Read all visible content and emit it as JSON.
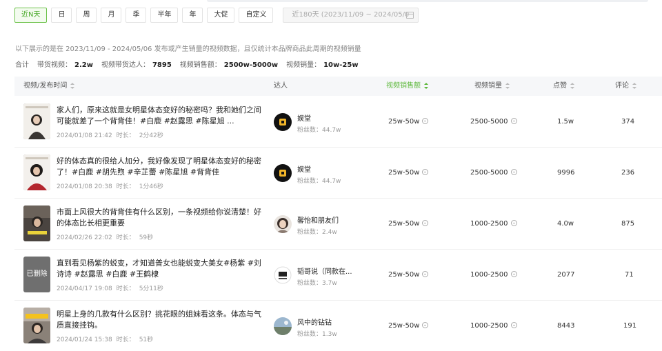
{
  "filters": {
    "options": [
      "近N天",
      "日",
      "周",
      "月",
      "季",
      "半年",
      "年",
      "大促",
      "自定义"
    ],
    "active_index": 0,
    "date_range": "近180天 (2023/11/09 ~ 2024/05/0"
  },
  "note": "以下展示的是在 2023/11/09 - 2024/05/06 发布或产生销量的视频数据，且仅统计本品牌商品此周期的视频销量",
  "summary": {
    "total_label": "合计",
    "items": [
      {
        "label": "带货视频：",
        "value": "2.2w"
      },
      {
        "label": "视频带货达人：",
        "value": "7895"
      },
      {
        "label": "视频销售额：",
        "value": "2500w-5000w"
      },
      {
        "label": "视频销量：",
        "value": "10w-25w"
      }
    ]
  },
  "table": {
    "headers": {
      "video": "视频/发布时间",
      "author": "达人",
      "sales_amount": "视频销售额",
      "sales_volume": "视频销量",
      "likes": "点赞",
      "comments": "评论"
    },
    "labels": {
      "duration": "时长：",
      "fans": "粉丝数："
    },
    "rows": [
      {
        "title": "家人们，原来这就是女明星体态变好的秘密吗？我和她们之间可能就差了一个背背佳！#白鹿 #赵露思 #陈星旭 ...",
        "date": "2024/01/08 21:42",
        "duration": "2分42秒",
        "author": "娱堂",
        "fans": "44.7w",
        "sales_amount": "25w-50w",
        "sales_volume": "2500-5000",
        "likes": "1.5w",
        "comments": "374"
      },
      {
        "title": "好的体态真的很给人加分，我好像发现了明星体态变好的秘密了！#白鹿 #胡先煦 #辛芷蕾 #陈星旭 #背背佳",
        "date": "2024/01/08 20:38",
        "duration": "1分46秒",
        "author": "娱堂",
        "fans": "44.7w",
        "sales_amount": "25w-50w",
        "sales_volume": "2500-5000",
        "likes": "9996",
        "comments": "236"
      },
      {
        "title": "市面上风很大的背背佳有什么区别，一条视频给你说清楚！好的体态比长相更重要",
        "date": "2024/02/26 22:02",
        "duration": "59秒",
        "author": "馨怡和朋友们",
        "fans": "2.4w",
        "sales_amount": "25w-50w",
        "sales_volume": "1000-2500",
        "likes": "4.0w",
        "comments": "875"
      },
      {
        "title": "直到看见杨紫的蜕变，才知道普女也能蜕变大美女#杨紫 #刘诗诗 #赵露思 #白鹿 #王鹤棣",
        "date": "2024/04/17 19:08",
        "duration": "5分11秒",
        "thumb_text": "已删除",
        "author": "韬哥说（同款在...",
        "fans": "3.7w",
        "sales_amount": "25w-50w",
        "sales_volume": "1000-2500",
        "likes": "2077",
        "comments": "71"
      },
      {
        "title": "明星上身的几款有什么区别？挑花眼的姐妹看这条。体态与气质直接挂钩。",
        "date": "2024/01/24 15:38",
        "duration": "51秒",
        "author": "风中的钻钻",
        "fans": "1.3w",
        "sales_amount": "25w-50w",
        "sales_volume": "1000-2500",
        "likes": "8443",
        "comments": "191"
      }
    ]
  },
  "colors": {
    "accent": "#5cb83a",
    "header_bg": "#f6f7f9"
  }
}
